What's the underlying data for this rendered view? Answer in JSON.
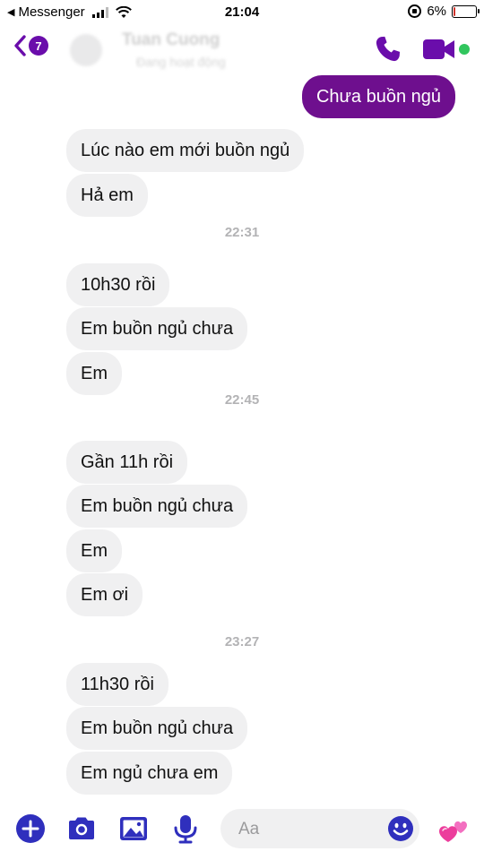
{
  "status_bar": {
    "back_app": "Messenger",
    "time": "21:04",
    "battery_percent": "6%",
    "battery_level": 0.06
  },
  "header": {
    "contact_name": "Tuan Cuong",
    "contact_status": "Đang hoạt động",
    "back_badge": "7"
  },
  "messages": [
    {
      "side": "out",
      "text": "Chưa buồn ngủ"
    },
    {
      "side": "in",
      "text": "Lúc nào em mới buồn ngủ"
    },
    {
      "side": "in",
      "text": "Hả em"
    },
    {
      "timestamp": "22:31"
    },
    {
      "side": "in",
      "text": "10h30 rồi"
    },
    {
      "side": "in",
      "text": "Em buồn ngủ chưa"
    },
    {
      "side": "in",
      "text": "Em"
    },
    {
      "timestamp": "22:45"
    },
    {
      "side": "in",
      "text": "Gần 11h rồi"
    },
    {
      "side": "in",
      "text": "Em buồn ngủ chưa"
    },
    {
      "side": "in",
      "text": "Em"
    },
    {
      "side": "in",
      "text": "Em ơi"
    },
    {
      "timestamp": "23:27"
    },
    {
      "side": "in",
      "text": "11h30 rồi"
    },
    {
      "side": "in",
      "text": "Em buồn ngủ chưa"
    },
    {
      "side": "in",
      "text": "Em ngủ chưa em"
    }
  ],
  "composer": {
    "placeholder": "Aa"
  },
  "icons": {
    "add": "plus-circle-icon",
    "camera": "camera-icon",
    "gallery": "image-icon",
    "voice": "microphone-icon",
    "emoji": "smiley-icon",
    "like": "hearts-icon",
    "call": "phone-icon",
    "video": "video-camera-icon"
  },
  "colors": {
    "accent": "#6e0f8e",
    "composer_accent": "#2f2fbd",
    "incoming_bubble": "#f0f0f1",
    "timestamp": "#b3b3b5",
    "online": "#31c65e"
  }
}
